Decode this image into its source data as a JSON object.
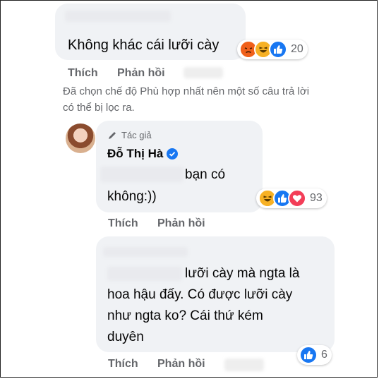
{
  "comment1": {
    "text": "Không khác cái lưỡi cày",
    "reactions": [
      "angry",
      "haha",
      "like"
    ],
    "reaction_count": "20",
    "actions": {
      "like": "Thích",
      "reply": "Phản hồi"
    }
  },
  "notice": {
    "line1": "Đã chọn chế độ Phù hợp nhất nên một số câu trả lời",
    "line2": "có thể bị lọc ra."
  },
  "reply1": {
    "badge": "Tác giả",
    "author": "Đỗ Thị Hà",
    "line1": "bạn có",
    "line2": "không:))",
    "reactions": [
      "haha",
      "like",
      "love"
    ],
    "reaction_count": "93",
    "actions": {
      "like": "Thích",
      "reply": "Phản hồi"
    }
  },
  "reply2": {
    "line1": "lưỡi cày mà ngta là",
    "line2": "hoa hậu đấy. Có được lưỡi cày",
    "line3": "như ngta ko? Cái thứ kém",
    "line4": "duyên",
    "reactions": [
      "like"
    ],
    "reaction_count": "6",
    "actions": {
      "like": "Thích",
      "reply": "Phản hồi"
    }
  },
  "colors": {
    "like": "#1877f2",
    "love": "#f33e58",
    "haha": "#f7b125",
    "angry": "#e9710f",
    "verified": "#1877f2"
  }
}
